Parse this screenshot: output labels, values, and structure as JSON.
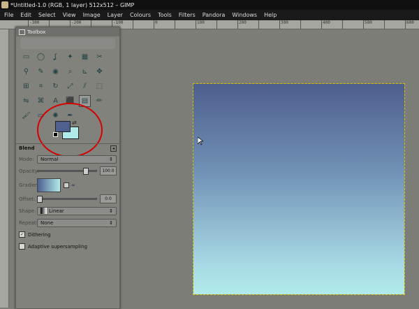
{
  "window": {
    "title": "*Untitled-1.0 (RGB, 1 layer) 512x512 – GIMP"
  },
  "menu": [
    "File",
    "Edit",
    "Select",
    "View",
    "Image",
    "Layer",
    "Colours",
    "Tools",
    "Filters",
    "Pandora",
    "Windows",
    "Help"
  ],
  "ruler": {
    "ticks": [
      "-300",
      "|",
      "-200",
      "|",
      "-100",
      "|",
      "0",
      "|",
      "100",
      "|",
      "200",
      "|",
      "300",
      "|",
      "400",
      "|",
      "500",
      "|",
      "600"
    ]
  },
  "toolbox": {
    "title": "Toolbox",
    "tools": [
      "rect-select",
      "ellipse-select",
      "free-select",
      "fuzzy-select",
      "select-by-color",
      "scissors",
      "foreground-select",
      "paths",
      "color-picker",
      "zoom",
      "measure",
      "move",
      "align",
      "crop",
      "rotate",
      "scale",
      "shear",
      "perspective",
      "flip",
      "cage",
      "text",
      "bucket-fill",
      "blend",
      "pencil",
      "paintbrush",
      "eraser",
      "airbrush",
      "ink",
      "clone",
      "heal",
      "perspective-clone",
      "blur",
      "smudge",
      "dodge-burn"
    ],
    "fg_color": "#4d5f8c",
    "bg_color": "#b1ebe9"
  },
  "blend": {
    "title": "Blend",
    "mode_label": "Mode:",
    "mode_value": "Normal",
    "opacity_label": "Opacity:",
    "opacity_value": "100.0",
    "gradient_label": "Gradient:",
    "offset_label": "Offset:",
    "offset_value": "0.0",
    "shape_label": "Shape:",
    "shape_value": "Linear",
    "repeat_label": "Repeat:",
    "repeat_value": "None",
    "dithering_label": "Dithering",
    "dithering_checked": true,
    "adaptive_label": "Adaptive supersampling",
    "adaptive_checked": false
  },
  "colors": {
    "gradient_top": "#4e5f8e",
    "gradient_bottom": "#b1ebe9",
    "highlight": "#d40000"
  }
}
